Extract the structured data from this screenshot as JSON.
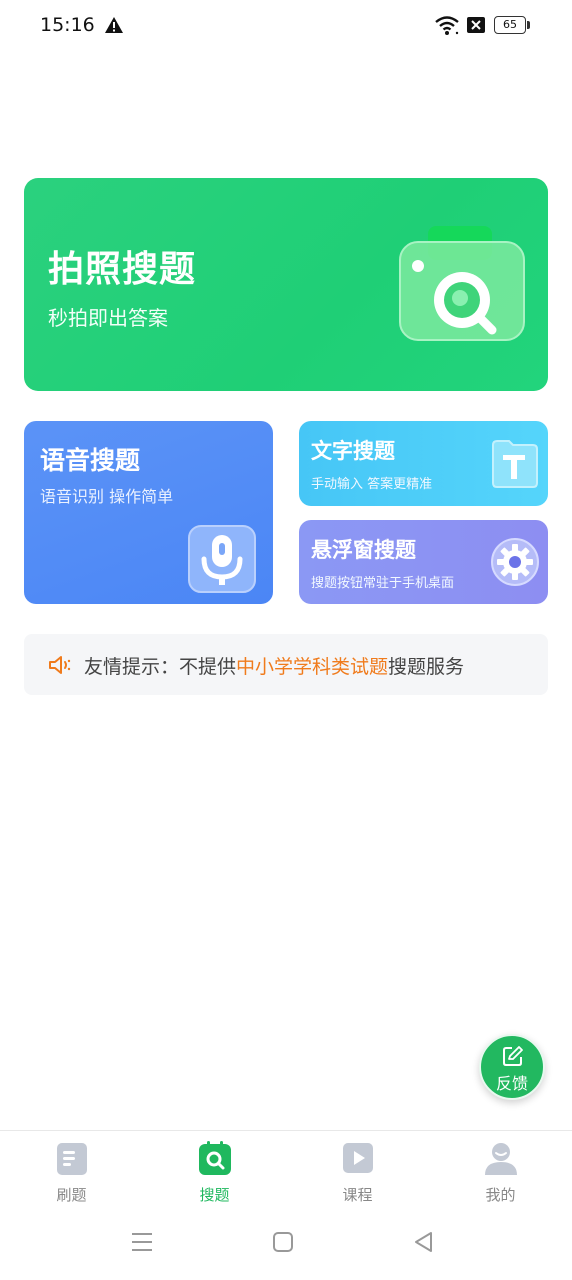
{
  "status_bar": {
    "time": "15:16",
    "battery_level": "65"
  },
  "hero": {
    "title": "拍照搜题",
    "subtitle": "秒拍即出答案",
    "color": "#22d07a"
  },
  "voice_search": {
    "title": "语音搜题",
    "subtitle": "语音识别 操作简单",
    "color": "#4f8af6"
  },
  "text_search": {
    "title": "文字搜题",
    "subtitle": "手动输入 答案更精准",
    "color": "#4ccdf8"
  },
  "float_search": {
    "title": "悬浮窗搜题",
    "subtitle": "搜题按钮常驻于手机桌面",
    "color": "#8c93f3"
  },
  "notice": {
    "prefix": "友情提示：不提供",
    "highlight": "中小学学科类试题",
    "suffix": "搜题服务",
    "highlight_color": "#f07b1c"
  },
  "feedback": {
    "label": "反馈"
  },
  "tabs": [
    {
      "label": "刷题",
      "icon": "document-icon",
      "active": false
    },
    {
      "label": "搜题",
      "icon": "search-calendar-icon",
      "active": true
    },
    {
      "label": "课程",
      "icon": "play-icon",
      "active": false
    },
    {
      "label": "我的",
      "icon": "user-icon",
      "active": false
    }
  ],
  "accent_color": "#1fb85e"
}
